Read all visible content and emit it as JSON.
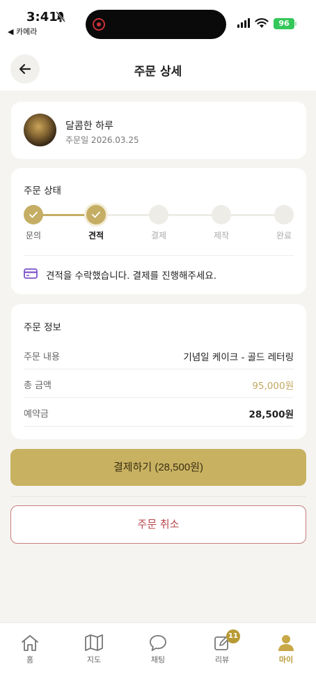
{
  "status_bar": {
    "time": "3:41",
    "back_app": "◀ 카메라",
    "battery": "96"
  },
  "header": {
    "title": "주문 상세"
  },
  "shop": {
    "name": "달콤한 하루",
    "order_date": "주문일 2026.03.25"
  },
  "order_status": {
    "title": "주문 상태",
    "steps": [
      {
        "label": "문의",
        "state": "done"
      },
      {
        "label": "견적",
        "state": "current"
      },
      {
        "label": "결제",
        "state": "pending"
      },
      {
        "label": "제작",
        "state": "pending"
      },
      {
        "label": "완료",
        "state": "pending"
      }
    ],
    "notice": "견적을 수락했습니다. 결제를 진행해주세요."
  },
  "order_info": {
    "title": "주문 정보",
    "rows": [
      {
        "key": "주문 내용",
        "value": "기념일 케이크 - 골드 레터링"
      },
      {
        "key": "총 금액",
        "value": "95,000원"
      },
      {
        "key": "예약금",
        "value": "28,500원"
      }
    ]
  },
  "actions": {
    "pay": "결제하기 (28,500원)",
    "cancel": "주문 취소"
  },
  "tabbar": {
    "items": [
      {
        "label": "홈",
        "icon": "home-icon"
      },
      {
        "label": "지도",
        "icon": "map-icon"
      },
      {
        "label": "채팅",
        "icon": "chat-icon"
      },
      {
        "label": "리뷰",
        "icon": "review-icon",
        "badge": "11"
      },
      {
        "label": "마이",
        "icon": "person-icon",
        "active": true
      }
    ]
  },
  "colors": {
    "accent": "#c8b262",
    "accent_dark": "#b89a35",
    "cancel": "#b8444a",
    "step_done": "#c5ae64",
    "step_pending": "#eeece6"
  }
}
